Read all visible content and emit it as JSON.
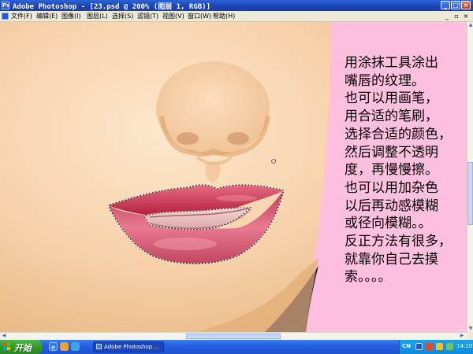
{
  "window": {
    "title": "Adobe Photoshop - [23.psd @ 200% (图层 1, RGB)]",
    "buttons": {
      "minimize": "_",
      "maximize": "□",
      "close": "×"
    }
  },
  "menu": {
    "items": [
      "文件(F)",
      "编辑(E)",
      "图像(I)",
      "图层(L)",
      "选择(S)",
      "滤镜(T)",
      "视图(V)",
      "窗口(W)",
      "帮助(H)"
    ],
    "doc_buttons": {
      "minimize": "_",
      "restore": "▫",
      "close": "×"
    }
  },
  "annotation": {
    "lines": [
      "用涂抹工具涂出",
      "嘴唇的纹理。",
      "也可以用画笔，",
      "用合适的笔刷，",
      "选择合适的颜色，",
      "然后调整不透明",
      "度，再慢慢擦。",
      "也可以用加杂色",
      "以后再动感模糊",
      "或径向模糊。。",
      "反正方法有很多，",
      "就靠你自己去摸",
      "索。。。。"
    ]
  },
  "taskbar": {
    "start_label": "开始",
    "task_button": "Adobe Photoshop ...",
    "lang": "CN",
    "clock": "14:10"
  },
  "colors": {
    "titlebar": "#1b46b8",
    "skin": "#f5cfa8",
    "pink_bg": "#ffbfdf",
    "lips": "#c8344e"
  }
}
